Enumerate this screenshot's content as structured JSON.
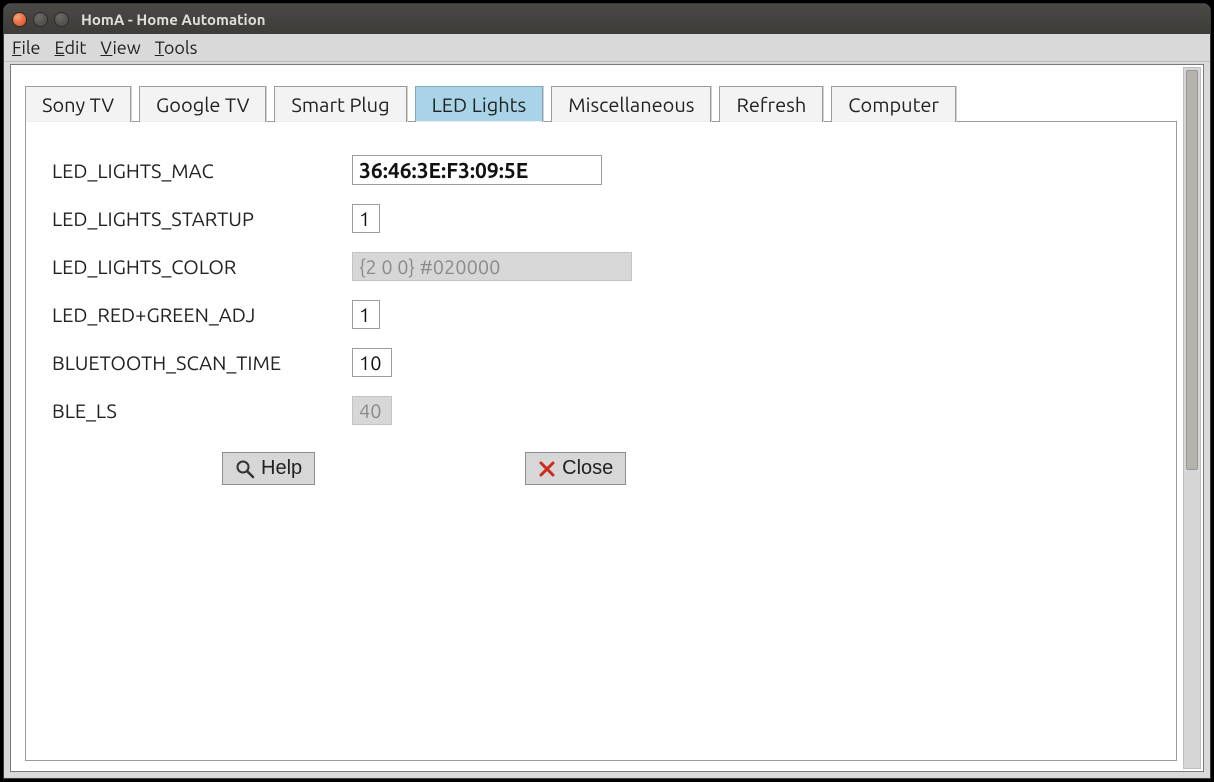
{
  "window": {
    "title": "HomA - Home Automation"
  },
  "menubar": {
    "file": "File",
    "edit": "Edit",
    "view": "View",
    "tools": "Tools"
  },
  "tabs": {
    "items": [
      {
        "label": "Sony TV"
      },
      {
        "label": "Google TV"
      },
      {
        "label": "Smart Plug"
      },
      {
        "label": "LED Lights"
      },
      {
        "label": "Miscellaneous"
      },
      {
        "label": "Refresh"
      },
      {
        "label": "Computer"
      }
    ],
    "active_index": 3
  },
  "form": {
    "rows": [
      {
        "label": "LED_LIGHTS_MAC",
        "value": "36:46:3E:F3:09:5E",
        "bold": true
      },
      {
        "label": "LED_LIGHTS_STARTUP",
        "value": "1"
      },
      {
        "label": "LED_LIGHTS_COLOR",
        "value": "{2 0 0} #020000",
        "disabled": true
      },
      {
        "label": "LED_RED+GREEN_ADJ",
        "value": "1"
      },
      {
        "label": "BLUETOOTH_SCAN_TIME",
        "value": "10"
      },
      {
        "label": "BLE_LS",
        "value": "40",
        "disabled": true
      }
    ]
  },
  "buttons": {
    "help": "Help",
    "close": "Close"
  }
}
